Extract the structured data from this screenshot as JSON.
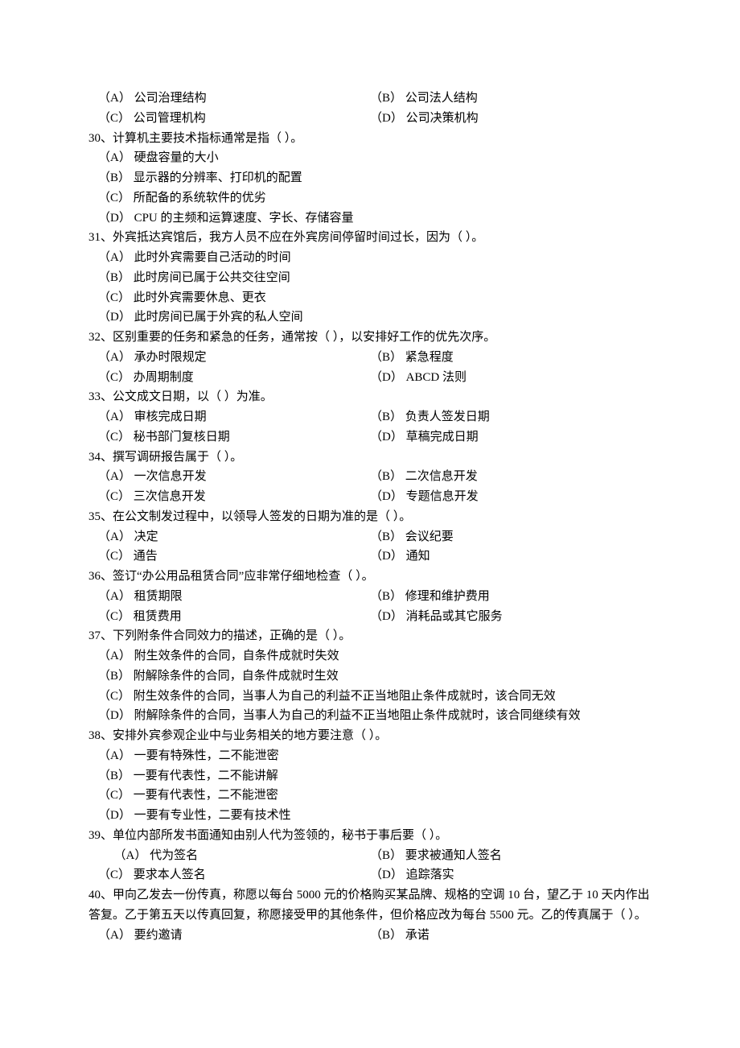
{
  "q29_opts": {
    "a": "（A）  公司治理结构",
    "b": "（B）  公司法人结构",
    "c": "（C）  公司管理机构",
    "d": "（D）  公司决策机构"
  },
  "q30": {
    "stem": "30、计算机主要技术指标通常是指（        ）。",
    "a": "（A）  硬盘容量的大小",
    "b": "（B）  显示器的分辨率、打印机的配置",
    "c": "（C）  所配备的系统软件的优劣",
    "d": "（D）  CPU 的主频和运算速度、字长、存储容量"
  },
  "q31": {
    "stem": "31、外宾抵达宾馆后，我方人员不应在外宾房间停留时间过长，因为（        ）。",
    "a": "（A）  此时外宾需要自己活动的时间",
    "b": "（B）  此时房间已属于公共交往空间",
    "c": "（C）  此时外宾需要休息、更衣",
    "d": "（D）  此时房间已属于外宾的私人空间"
  },
  "q32": {
    "stem": "32、区别重要的任务和紧急的任务，通常按（        ），以安排好工作的优先次序。",
    "a": "（A）  承办时限规定",
    "b": "（B）  紧急程度",
    "c": "（C）  办周期制度",
    "d": "（D）  ABCD 法则"
  },
  "q33": {
    "stem": "33、公文成文日期，以（        ）为准。",
    "a": "（A）  审核完成日期",
    "b": "（B）  负责人签发日期",
    "c": "（C）  秘书部门复核日期",
    "d": "（D）  草稿完成日期"
  },
  "q34": {
    "stem": "34、撰写调研报告属于（        ）。",
    "a": "（A）  一次信息开发",
    "b": "（B）  二次信息开发",
    "c": "（C）  三次信息开发",
    "d": "（D）  专题信息开发"
  },
  "q35": {
    "stem": "35、在公文制发过程中，以领导人签发的日期为准的是（        ）。",
    "a": "（A）  决定",
    "b": "（B）  会议纪要",
    "c": "（C）  通告",
    "d": "（D）  通知"
  },
  "q36": {
    "stem": "36、签订“办公用品租赁合同”应非常仔细地检查（        ）。",
    "a": "（A）  租赁期限",
    "b": "（B）  修理和维护费用",
    "c": "（C）  租赁费用",
    "d": "（D）  消耗品或其它服务"
  },
  "q37": {
    "stem": "37、下列附条件合同效力的描述，正确的是（        ）。",
    "a": "（A）  附生效条件的合同，自条件成就时失效",
    "b": "（B）  附解除条件的合同，自条件成就时生效",
    "c": "（C）  附生效条件的合同，当事人为自己的利益不正当地阻止条件成就时，该合同无效",
    "d": "（D）  附解除条件的合同，当事人为自己的利益不正当地阻止条件成就时，该合同继续有效"
  },
  "q38": {
    "stem": "38、安排外宾参观企业中与业务相关的地方要注意（        ）。",
    "a": "（A）  一要有特殊性，二不能泄密",
    "b": "（B）  一要有代表性，二不能讲解",
    "c": "（C）  一要有代表性，二不能泄密",
    "d": "（D）  一要有专业性，二要有技术性"
  },
  "q39": {
    "stem": "39、单位内部所发书面通知由别人代为签领的，秘书于事后要（        ）。",
    "a": "（A）  代为签名",
    "b": "（B）  要求被通知人签名",
    "c": "（C）  要求本人签名",
    "d": "（D）  追踪落实"
  },
  "q40": {
    "stem": "40、甲向乙发去一份传真，称愿以每台 5000 元的价格购买某品牌、规格的空调 10 台，望乙于 10 天内作出答复。乙于第五天以传真回复，称愿接受甲的其他条件，但价格应改为每台 5500 元。乙的传真属于（        ）。",
    "a": "（A）  要约邀请",
    "b": "（B）  承诺"
  }
}
